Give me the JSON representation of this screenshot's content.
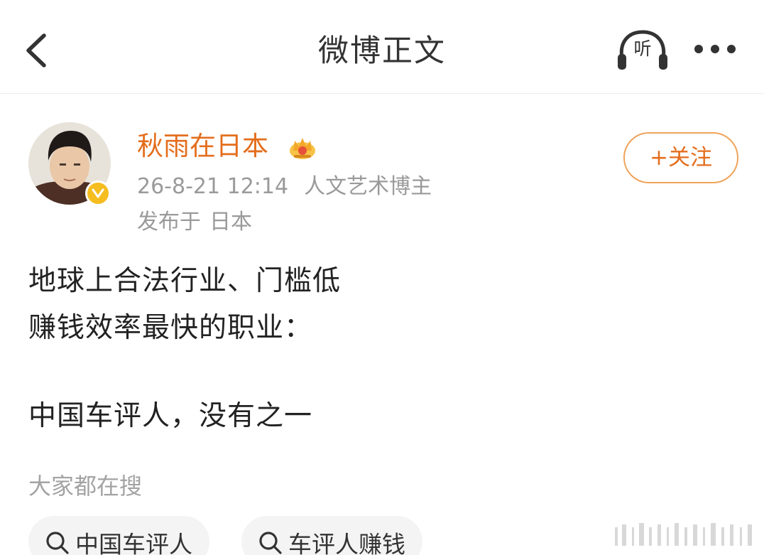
{
  "header": {
    "title": "微博正文",
    "listen_label": "听"
  },
  "author": {
    "name": "秋雨在日本",
    "date": "26-8-21 12:14",
    "tag": "人文艺术博主",
    "location_prefix": "发布于",
    "location": "日本",
    "follow_label": "+关注"
  },
  "post": {
    "lines": [
      "地球上合法行业、门槛低",
      "赚钱效率最快的职业：",
      "中国车评人，没有之一"
    ]
  },
  "hot_search": {
    "title": "大家都在搜",
    "items": [
      "中国车评人",
      "车评人赚钱"
    ]
  },
  "colors": {
    "accent": "#e46e1d",
    "follow_border": "#f0a35a",
    "verified_badge": "#f5bd1f",
    "meta_text": "#9a9a9a"
  },
  "icons": [
    "back-arrow-icon",
    "headphones-icon",
    "more-dots-icon",
    "crown-icon",
    "verified-check-icon",
    "search-icon"
  ]
}
